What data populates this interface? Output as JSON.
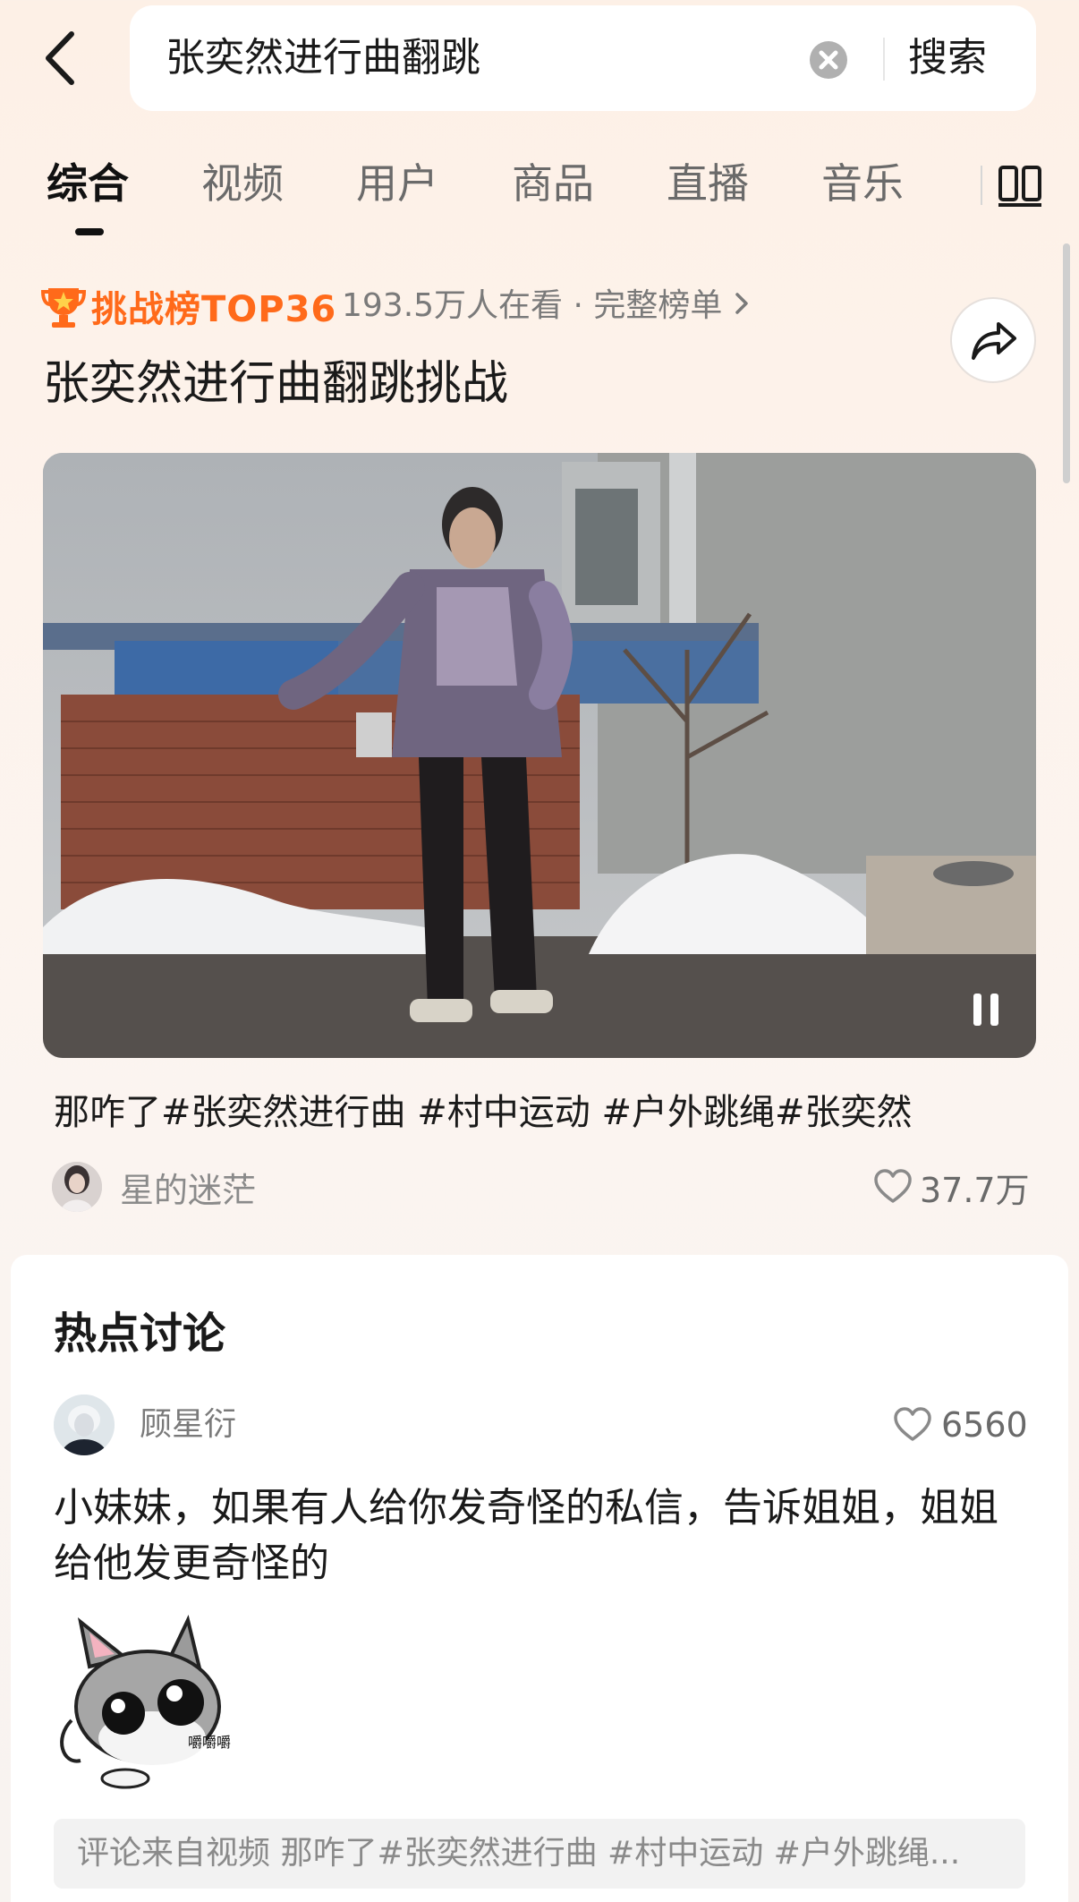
{
  "search": {
    "query": "张奕然进行曲翻跳",
    "submit_label": "搜索"
  },
  "tabs": [
    {
      "label": "综合",
      "active": true
    },
    {
      "label": "视频",
      "active": false
    },
    {
      "label": "用户",
      "active": false
    },
    {
      "label": "商品",
      "active": false
    },
    {
      "label": "直播",
      "active": false
    },
    {
      "label": "音乐",
      "active": false
    }
  ],
  "challenge": {
    "badge": "挑战榜TOP36",
    "viewers": "193.5万人在看 · 完整榜单",
    "title": "张奕然进行曲翻跳挑战"
  },
  "video": {
    "caption": "那咋了#张奕然进行曲 #村中运动 #户外跳绳#张奕然",
    "author": "星的迷茫",
    "likes": "37.7万"
  },
  "hot_discussion": {
    "title": "热点讨论",
    "comment": {
      "user": "顾星衍",
      "likes": "6560",
      "text": "小妹妹，如果有人给你发奇怪的私信，告诉姐姐，姐姐给他发更奇怪的",
      "sticker_text": "嚼嚼嚼",
      "source": "评论来自视频 那咋了#张奕然进行曲 #村中运动 #户外跳绳..."
    }
  },
  "colors": {
    "accent": "#ff6a1a",
    "text_primary": "#1a1a1a",
    "text_secondary": "#7a7a7a"
  },
  "icons": [
    "back-arrow-icon",
    "clear-icon",
    "filter-icon",
    "trophy-icon",
    "chevron-right-icon",
    "share-icon",
    "pause-icon",
    "heart-icon"
  ]
}
